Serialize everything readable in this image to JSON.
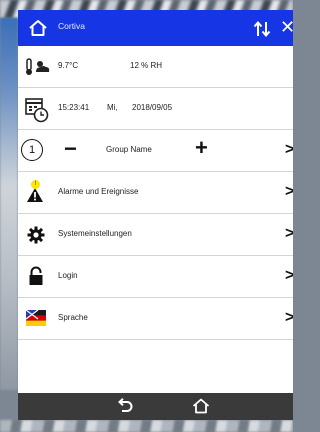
{
  "header": {
    "title": "Cortiva",
    "icons": [
      "home-icon",
      "sort-icon",
      "close-icon"
    ]
  },
  "climate": {
    "temperature": "9.7°C",
    "humidity": "12 % RH"
  },
  "datetime": {
    "time": "15:23:41",
    "weekday": "Mi,",
    "date": "2018/09/05"
  },
  "group": {
    "number": "1",
    "minus": "−",
    "name": "Group Name",
    "plus": "+"
  },
  "menu": {
    "alarms": "Alarme und Ereignisse",
    "settings": "Systemeinstellungen",
    "login": "Login",
    "language": "Sprache"
  },
  "alarm_badge": "!",
  "colors": {
    "header": "#1636e6",
    "nav": "#3a3a3a",
    "badge": "#ffe600"
  }
}
